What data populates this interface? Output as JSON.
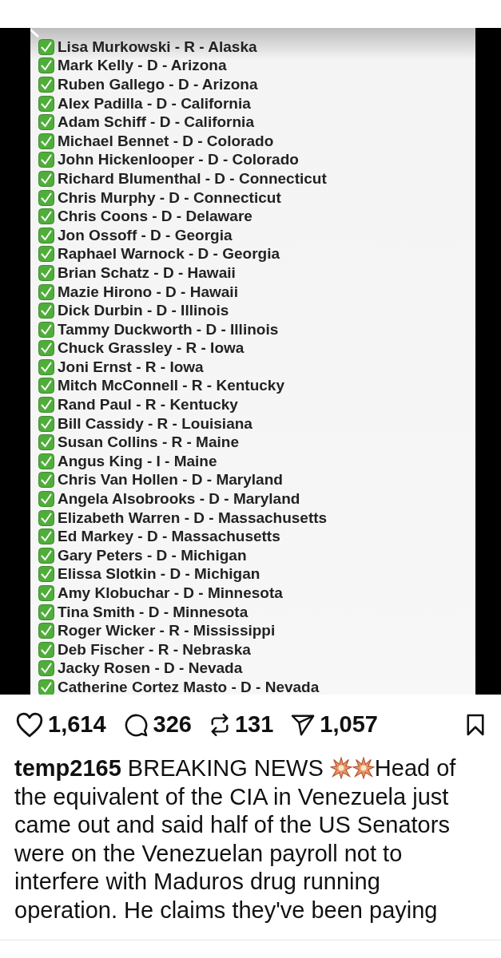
{
  "image": {
    "rows": [
      {
        "text": "Lisa Murkowski - R - Alaska",
        "checked": true
      },
      {
        "text": "Mark Kelly - D - Arizona",
        "checked": true
      },
      {
        "text": "Ruben Gallego - D - Arizona",
        "checked": true
      },
      {
        "text": "Alex Padilla - D - California",
        "checked": true
      },
      {
        "text": "Adam Schiff - D - California",
        "checked": true
      },
      {
        "text": "Michael Bennet - D - Colorado",
        "checked": true
      },
      {
        "text": "John Hickenlooper - D - Colorado",
        "checked": true
      },
      {
        "text": "Richard Blumenthal - D - Connecticut",
        "checked": true
      },
      {
        "text": "Chris Murphy - D - Connecticut",
        "checked": true
      },
      {
        "text": "Chris Coons - D - Delaware",
        "checked": true
      },
      {
        "text": "Jon Ossoff - D - Georgia",
        "checked": true
      },
      {
        "text": "Raphael Warnock - D - Georgia",
        "checked": true
      },
      {
        "text": "Brian Schatz - D - Hawaii",
        "checked": true
      },
      {
        "text": "Mazie Hirono - D - Hawaii",
        "checked": true
      },
      {
        "text": "Dick Durbin - D - Illinois",
        "checked": true
      },
      {
        "text": "Tammy Duckworth - D - Illinois",
        "checked": true
      },
      {
        "text": "Chuck Grassley - R - Iowa",
        "checked": true
      },
      {
        "text": "Joni Ernst - R - Iowa",
        "checked": true
      },
      {
        "text": "Mitch McConnell - R - Kentucky",
        "checked": true
      },
      {
        "text": "Rand Paul - R - Kentucky",
        "checked": true
      },
      {
        "text": "Bill Cassidy - R - Louisiana",
        "checked": true
      },
      {
        "text": "Susan Collins - R - Maine",
        "checked": true
      },
      {
        "text": "Angus King - I - Maine",
        "checked": true
      },
      {
        "text": "Chris Van Hollen - D - Maryland",
        "checked": true
      },
      {
        "text": "Angela Alsobrooks - D - Maryland",
        "checked": true
      },
      {
        "text": "Elizabeth Warren - D - Massachusetts",
        "checked": true
      },
      {
        "text": "Ed Markey - D - Massachusetts",
        "checked": true
      },
      {
        "text": "Gary Peters - D - Michigan",
        "checked": true
      },
      {
        "text": "Elissa Slotkin - D - Michigan",
        "checked": true
      },
      {
        "text": "Amy Klobuchar - D - Minnesota",
        "checked": true
      },
      {
        "text": "Tina Smith - D - Minnesota",
        "checked": true
      },
      {
        "text": "Roger Wicker - R - Mississippi",
        "checked": true
      },
      {
        "text": "Deb Fischer - R - Nebraska",
        "checked": true
      },
      {
        "text": "Jacky Rosen - D - Nevada",
        "checked": true
      },
      {
        "text": "Catherine Cortez Masto - D - Nevada",
        "checked": true
      }
    ]
  },
  "actions": {
    "likes": "1,614",
    "comments": "326",
    "reposts": "131",
    "shares": "1,057"
  },
  "caption": {
    "username": "temp2165",
    "headline": "BREAKING NEWS",
    "body": "Head of the equivalent of the CIA in Venezuela just came out and said half of the US Senators were on the Venezuelan payroll not to interfere with Maduros drug running operation. He claims they've been paying"
  }
}
